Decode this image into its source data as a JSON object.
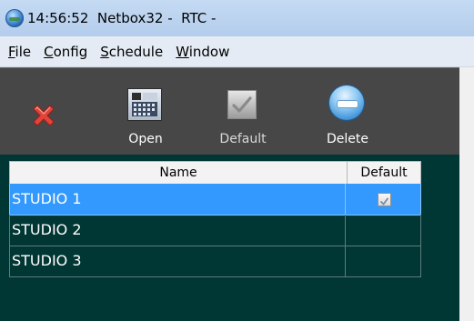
{
  "window": {
    "title": "14:56:52  Netbox32 -  RTC -"
  },
  "menubar": {
    "items": [
      {
        "u": "F",
        "rest": "ile"
      },
      {
        "u": "C",
        "rest": "onfig"
      },
      {
        "u": "S",
        "rest": "chedule"
      },
      {
        "u": "W",
        "rest": "indow"
      }
    ]
  },
  "toolbar": {
    "open_label": "Open",
    "default_label": "Default",
    "delete_label": "Delete"
  },
  "grid": {
    "columns": [
      "Name",
      "Default"
    ],
    "rows": [
      {
        "name": "STUDIO 1",
        "default": true,
        "selected": true
      },
      {
        "name": "STUDIO 2",
        "default": false,
        "selected": false
      },
      {
        "name": "STUDIO 3",
        "default": false,
        "selected": false
      }
    ]
  },
  "colors": {
    "toolbar_bg": "#474747",
    "grid_bg": "#003633",
    "selection": "#3399ff"
  }
}
